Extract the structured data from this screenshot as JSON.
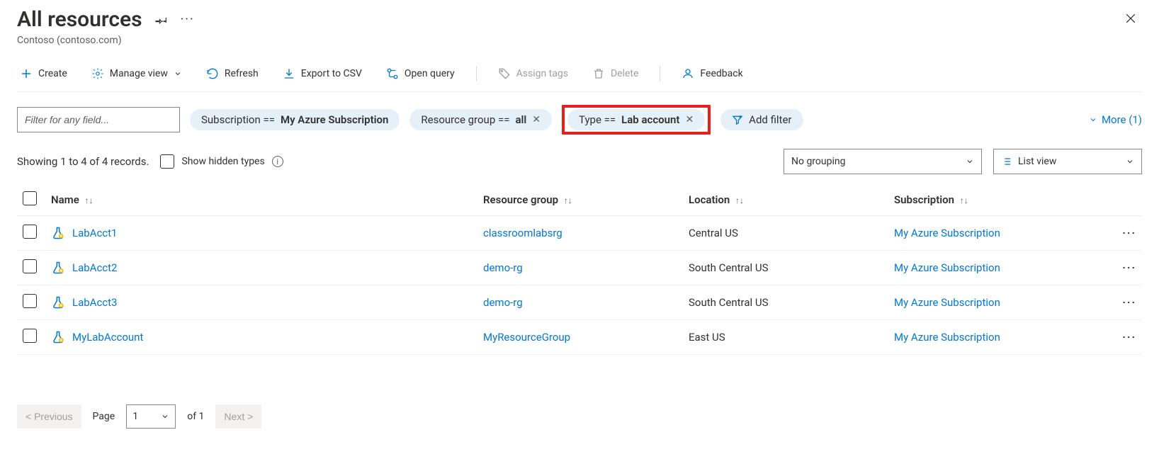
{
  "header": {
    "title": "All resources",
    "subtitle": "Contoso (contoso.com)"
  },
  "toolbar": {
    "create": "Create",
    "manage_view": "Manage view",
    "refresh": "Refresh",
    "export_csv": "Export to CSV",
    "open_query": "Open query",
    "assign_tags": "Assign tags",
    "delete": "Delete",
    "feedback": "Feedback"
  },
  "filters": {
    "placeholder": "Filter for any field...",
    "subscription_label": "Subscription == ",
    "subscription_value": "My Azure Subscription",
    "rg_label": "Resource group == ",
    "rg_value": "all",
    "type_label": "Type == ",
    "type_value": "Lab account",
    "add_filter": "Add filter",
    "more": "More (1)"
  },
  "status": {
    "showing": "Showing 1 to 4 of 4 records.",
    "show_hidden": "Show hidden types",
    "grouping": "No grouping",
    "view_mode": "List view"
  },
  "columns": {
    "name": "Name",
    "rg": "Resource group",
    "location": "Location",
    "subscription": "Subscription"
  },
  "rows": [
    {
      "name": "LabAcct1",
      "rg": "classroomlabsrg",
      "location": "Central US",
      "subscription": "My Azure Subscription"
    },
    {
      "name": "LabAcct2",
      "rg": "demo-rg",
      "location": "South Central US",
      "subscription": "My Azure Subscription"
    },
    {
      "name": "LabAcct3",
      "rg": "demo-rg",
      "location": "South Central US",
      "subscription": "My Azure Subscription"
    },
    {
      "name": "MyLabAccount",
      "rg": "MyResourceGroup",
      "location": "East US",
      "subscription": "My Azure Subscription"
    }
  ],
  "pager": {
    "previous": "< Previous",
    "page_label": "Page",
    "page_value": "1",
    "of_label": "of 1",
    "next": "Next >"
  }
}
